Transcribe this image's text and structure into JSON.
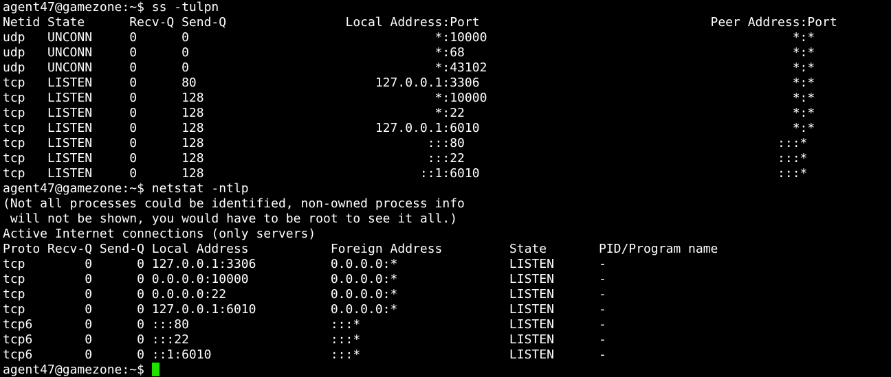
{
  "colors": {
    "background": "#000000",
    "foreground": "#ffffff",
    "cursor": "#22e000"
  },
  "terminal": {
    "lines": [
      "agent47@gamezone:~$ ss -tulpn",
      "Netid State      Recv-Q Send-Q                Local Address:Port                               Peer Address:Port",
      "udp   UNCONN     0      0                                 *:10000                                         *:*",
      "udp   UNCONN     0      0                                 *:68                                            *:*",
      "udp   UNCONN     0      0                                 *:43102                                         *:*",
      "tcp   LISTEN     0      80                        127.0.0.1:3306                                          *:*",
      "tcp   LISTEN     0      128                               *:10000                                         *:*",
      "tcp   LISTEN     0      128                               *:22                                            *:*",
      "tcp   LISTEN     0      128                       127.0.0.1:6010                                          *:*",
      "tcp   LISTEN     0      128                              :::80                                          :::*",
      "tcp   LISTEN     0      128                              :::22                                          :::*",
      "tcp   LISTEN     0      128                             ::1:6010                                        :::*",
      "agent47@gamezone:~$ netstat -ntlp",
      "(Not all processes could be identified, non-owned process info",
      " will not be shown, you would have to be root to see it all.)",
      "Active Internet connections (only servers)",
      "Proto Recv-Q Send-Q Local Address           Foreign Address         State       PID/Program name",
      "tcp        0      0 127.0.0.1:3306          0.0.0.0:*               LISTEN      -",
      "tcp        0      0 0.0.0.0:10000           0.0.0.0:*               LISTEN      -",
      "tcp        0      0 0.0.0.0:22              0.0.0.0:*               LISTEN      -",
      "tcp        0      0 127.0.0.1:6010          0.0.0.0:*               LISTEN      -",
      "tcp6       0      0 :::80                   :::*                    LISTEN      -",
      "tcp6       0      0 :::22                   :::*                    LISTEN      -",
      "tcp6       0      0 ::1:6010                :::*                    LISTEN      -"
    ],
    "prompt": "agent47@gamezone:~$ "
  }
}
